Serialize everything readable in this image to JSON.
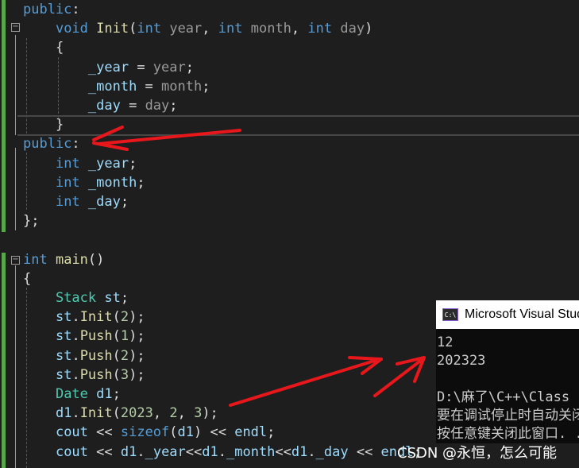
{
  "editor": {
    "lines": [
      {
        "id": "l1",
        "parts": [
          [
            "kw",
            "public"
          ],
          [
            "plain",
            ":"
          ]
        ]
      },
      {
        "id": "l2",
        "parts": [
          [
            "plain",
            "    "
          ],
          [
            "kw",
            "void"
          ],
          [
            "plain",
            " "
          ],
          [
            "fn",
            "Init"
          ],
          [
            "plain",
            "("
          ],
          [
            "kw",
            "int"
          ],
          [
            "plain",
            " "
          ],
          [
            "par",
            "year"
          ],
          [
            "plain",
            ", "
          ],
          [
            "kw",
            "int"
          ],
          [
            "plain",
            " "
          ],
          [
            "par",
            "month"
          ],
          [
            "plain",
            ", "
          ],
          [
            "kw",
            "int"
          ],
          [
            "plain",
            " "
          ],
          [
            "par",
            "day"
          ],
          [
            "plain",
            ")"
          ]
        ]
      },
      {
        "id": "l3",
        "parts": [
          [
            "plain",
            "    {"
          ]
        ]
      },
      {
        "id": "l4",
        "parts": [
          [
            "plain",
            "        "
          ],
          [
            "var",
            "_year"
          ],
          [
            "plain",
            " = "
          ],
          [
            "par",
            "year"
          ],
          [
            "plain",
            ";"
          ]
        ]
      },
      {
        "id": "l5",
        "parts": [
          [
            "plain",
            "        "
          ],
          [
            "var",
            "_month"
          ],
          [
            "plain",
            " = "
          ],
          [
            "par",
            "month"
          ],
          [
            "plain",
            ";"
          ]
        ]
      },
      {
        "id": "l6",
        "parts": [
          [
            "plain",
            "        "
          ],
          [
            "var",
            "_day"
          ],
          [
            "plain",
            " = "
          ],
          [
            "par",
            "day"
          ],
          [
            "plain",
            ";"
          ]
        ]
      },
      {
        "id": "l7",
        "parts": [
          [
            "plain",
            "    }"
          ]
        ]
      },
      {
        "id": "l8",
        "parts": [
          [
            "kw",
            "public"
          ],
          [
            "plain",
            ":"
          ]
        ]
      },
      {
        "id": "l9",
        "parts": [
          [
            "plain",
            "    "
          ],
          [
            "kw",
            "int"
          ],
          [
            "plain",
            " "
          ],
          [
            "var",
            "_year"
          ],
          [
            "plain",
            ";"
          ]
        ]
      },
      {
        "id": "l10",
        "parts": [
          [
            "plain",
            "    "
          ],
          [
            "kw",
            "int"
          ],
          [
            "plain",
            " "
          ],
          [
            "var",
            "_month"
          ],
          [
            "plain",
            ";"
          ]
        ]
      },
      {
        "id": "l11",
        "parts": [
          [
            "plain",
            "    "
          ],
          [
            "kw",
            "int"
          ],
          [
            "plain",
            " "
          ],
          [
            "var",
            "_day"
          ],
          [
            "plain",
            ";"
          ]
        ]
      },
      {
        "id": "l12",
        "parts": [
          [
            "plain",
            "};"
          ]
        ]
      },
      {
        "id": "l13",
        "parts": []
      },
      {
        "id": "l14",
        "parts": [
          [
            "kw",
            "int"
          ],
          [
            "plain",
            " "
          ],
          [
            "fn",
            "main"
          ],
          [
            "plain",
            "()"
          ]
        ]
      },
      {
        "id": "l15",
        "parts": [
          [
            "plain",
            "{"
          ]
        ]
      },
      {
        "id": "l16",
        "parts": [
          [
            "plain",
            "    "
          ],
          [
            "ty",
            "Stack"
          ],
          [
            "plain",
            " "
          ],
          [
            "var",
            "st"
          ],
          [
            "plain",
            ";"
          ]
        ]
      },
      {
        "id": "l17",
        "parts": [
          [
            "plain",
            "    "
          ],
          [
            "var",
            "st"
          ],
          [
            "plain",
            "."
          ],
          [
            "fn",
            "Init"
          ],
          [
            "plain",
            "("
          ],
          [
            "num",
            "2"
          ],
          [
            "plain",
            ");"
          ]
        ]
      },
      {
        "id": "l18",
        "parts": [
          [
            "plain",
            "    "
          ],
          [
            "var",
            "st"
          ],
          [
            "plain",
            "."
          ],
          [
            "fn",
            "Push"
          ],
          [
            "plain",
            "("
          ],
          [
            "num",
            "1"
          ],
          [
            "plain",
            ");"
          ]
        ]
      },
      {
        "id": "l19",
        "parts": [
          [
            "plain",
            "    "
          ],
          [
            "var",
            "st"
          ],
          [
            "plain",
            "."
          ],
          [
            "fn",
            "Push"
          ],
          [
            "plain",
            "("
          ],
          [
            "num",
            "2"
          ],
          [
            "plain",
            ");"
          ]
        ]
      },
      {
        "id": "l20",
        "parts": [
          [
            "plain",
            "    "
          ],
          [
            "var",
            "st"
          ],
          [
            "plain",
            "."
          ],
          [
            "fn",
            "Push"
          ],
          [
            "plain",
            "("
          ],
          [
            "num",
            "3"
          ],
          [
            "plain",
            ");"
          ]
        ]
      },
      {
        "id": "l21",
        "parts": [
          [
            "plain",
            "    "
          ],
          [
            "ty",
            "Date"
          ],
          [
            "plain",
            " "
          ],
          [
            "var",
            "d1"
          ],
          [
            "plain",
            ";"
          ]
        ]
      },
      {
        "id": "l22",
        "parts": [
          [
            "plain",
            "    "
          ],
          [
            "var",
            "d1"
          ],
          [
            "plain",
            "."
          ],
          [
            "fn",
            "Init"
          ],
          [
            "plain",
            "("
          ],
          [
            "num",
            "2023"
          ],
          [
            "plain",
            ", "
          ],
          [
            "num",
            "2"
          ],
          [
            "plain",
            ", "
          ],
          [
            "num",
            "3"
          ],
          [
            "plain",
            ");"
          ]
        ]
      },
      {
        "id": "l23",
        "parts": [
          [
            "plain",
            "    "
          ],
          [
            "var",
            "cout"
          ],
          [
            "plain",
            " << "
          ],
          [
            "kw",
            "sizeof"
          ],
          [
            "plain",
            "("
          ],
          [
            "var",
            "d1"
          ],
          [
            "plain",
            ") << "
          ],
          [
            "var",
            "endl"
          ],
          [
            "plain",
            ";"
          ]
        ]
      },
      {
        "id": "l24",
        "parts": [
          [
            "plain",
            "    "
          ],
          [
            "var",
            "cout"
          ],
          [
            "plain",
            " << "
          ],
          [
            "var",
            "d1"
          ],
          [
            "plain",
            "."
          ],
          [
            "var",
            "_year"
          ],
          [
            "plain",
            "<<"
          ],
          [
            "var",
            "d1"
          ],
          [
            "plain",
            "."
          ],
          [
            "var",
            "_month"
          ],
          [
            "plain",
            "<<"
          ],
          [
            "var",
            "d1"
          ],
          [
            "plain",
            "."
          ],
          [
            "var",
            "_day"
          ],
          [
            "plain",
            " << "
          ],
          [
            "var",
            "endl"
          ],
          [
            "plain",
            ";"
          ]
        ]
      }
    ],
    "fold_markers": {
      "collapse": "−"
    }
  },
  "console": {
    "icon_text": "C:\\",
    "title": "Microsoft Visual Studio Debug Console",
    "output": [
      "12",
      "202323",
      "",
      "D:\\麻了\\C++\\Class",
      "要在调试停止时自动关闭控制台",
      "按任意键关闭此窗口. . ."
    ]
  },
  "watermark": "CSDN @永恒，怎么可能",
  "colors": {
    "keyword": "#569cd6",
    "type": "#4ec9b0",
    "function": "#dcdcaa",
    "variable": "#9cdcfe",
    "parameter": "#9a9a9a",
    "number": "#b5cea8",
    "arrow": "#e8171b",
    "change_bar": "#57a64a"
  }
}
